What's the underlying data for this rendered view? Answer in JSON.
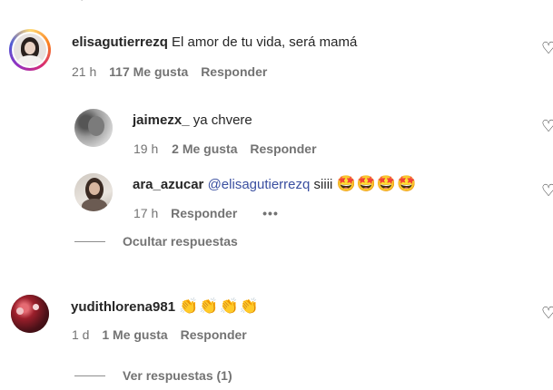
{
  "comments": [
    {
      "username": "elisagutierrezq",
      "text": "El amor de tu vida, será mamá",
      "time": "21 h",
      "likes": "117 Me gusta",
      "reply": "Responder"
    }
  ],
  "replies": [
    {
      "username": "jaimezx_",
      "text": "ya chvere",
      "time": "19 h",
      "likes": "2 Me gusta",
      "reply": "Responder"
    },
    {
      "username": "ara_azucar",
      "mention": "@elisagutierrezq",
      "text": "siiii",
      "emojis": "🤩🤩🤩🤩",
      "time": "17 h",
      "reply": "Responder",
      "more": "•••"
    }
  ],
  "hide_replies": "Ocultar respuestas",
  "comment2": {
    "username": "yudithlorena981",
    "emojis": "👏👏👏👏",
    "time": "1 d",
    "likes": "1 Me gusta",
    "reply": "Responder"
  },
  "view_replies": "Ver respuestas (1)",
  "icons": [
    "heart-icon",
    "more-options-icon"
  ],
  "colors": {
    "text": "#262626",
    "meta": "#737373",
    "mention": "#3a4fa0",
    "story_ring": "#d6249f"
  }
}
